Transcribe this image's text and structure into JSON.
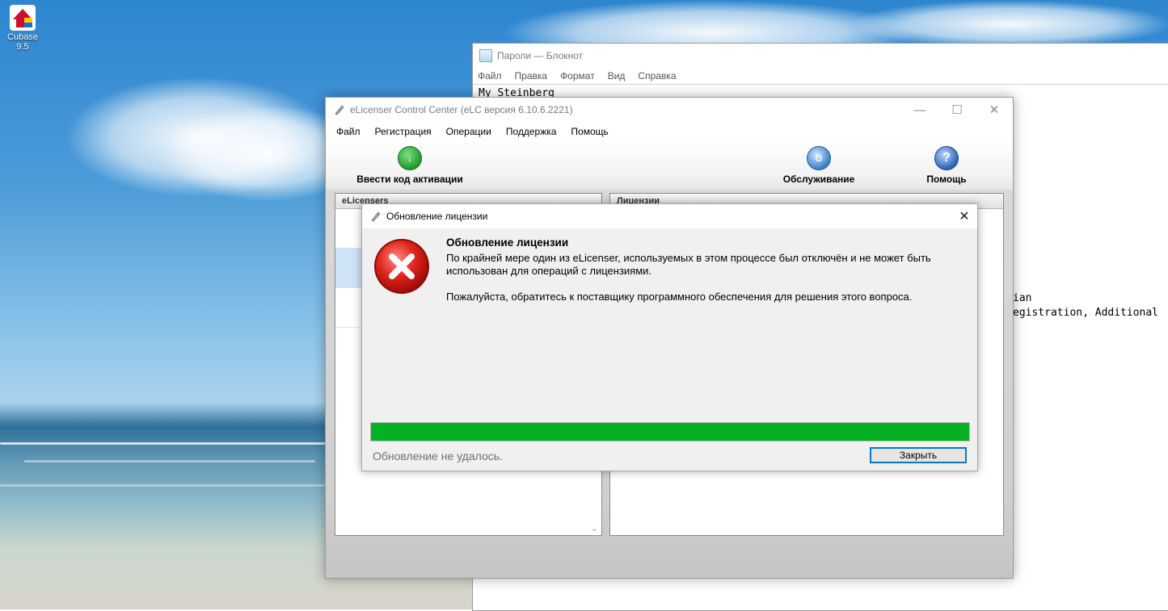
{
  "desktop": {
    "icon_label": "Cubase 9.5"
  },
  "notepad": {
    "title": "Пароли — Блокнот",
    "menu": [
      "Файл",
      "Правка",
      "Формат",
      "Вид",
      "Справка"
    ],
    "lines": [
      "My Steinberg",
      "ian",
      "egistration, Additional"
    ]
  },
  "elc": {
    "title": "eLicenser Control Center (eLC версия 6.10.6.2221)",
    "menu": [
      "Файл",
      "Регистрация",
      "Операции",
      "Поддержка",
      "Помощь"
    ],
    "toolbar": {
      "activate_label": "Ввести код активации",
      "maintenance_label": "Обслуживание",
      "help_label": "Помощь"
    },
    "left_panel_header": "eLicensers",
    "right_panel_header": "Лицензии"
  },
  "dialog": {
    "title": "Обновление лицензии",
    "heading": "Обновление лицензии",
    "message": "По крайней мере один из eLicenser, используемых в этом процессе был отключён и не может быть использован для операций с лицензиями.",
    "hint": "Пожалуйста, обратитесь к поставщику программного обеспечения для решения этого вопроса.",
    "progress": 1.0,
    "status": "Обновление не удалось.",
    "close_button": "Закрыть"
  }
}
